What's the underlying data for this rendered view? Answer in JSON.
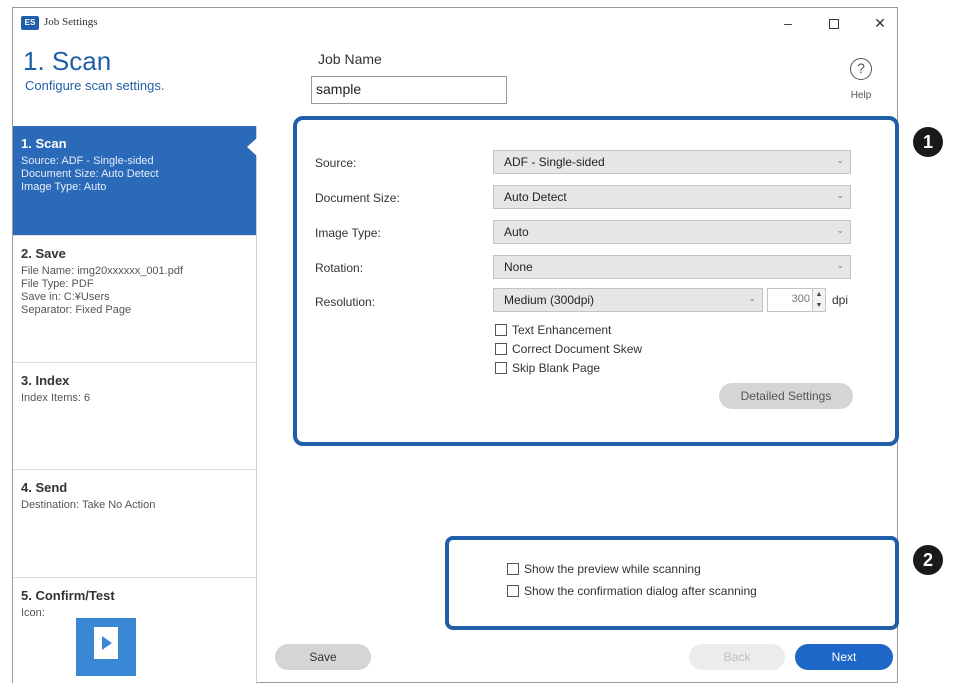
{
  "window": {
    "title": "Job Settings",
    "app_icon_text": "ES",
    "controls": {
      "minimize": "–",
      "close": "✕"
    }
  },
  "header": {
    "step_title": "1. Scan",
    "step_subtitle": "Configure scan settings.",
    "job_name_label": "Job Name",
    "job_name_value": "sample",
    "help_label": "Help",
    "help_icon": "?"
  },
  "sidebar": {
    "items": [
      {
        "title": "1. Scan",
        "lines": [
          "Source: ADF - Single-sided",
          "Document Size: Auto Detect",
          "Image Type: Auto"
        ]
      },
      {
        "title": "2. Save",
        "lines": [
          "File Name: img20xxxxxx_001.pdf",
          "File Type: PDF",
          "Save in: C:¥Users",
          "Separator: Fixed Page"
        ]
      },
      {
        "title": "3. Index",
        "lines": [
          "Index Items: 6"
        ]
      },
      {
        "title": "4. Send",
        "lines": [
          "Destination: Take No Action"
        ]
      },
      {
        "title": "5. Confirm/Test",
        "lines": [
          "Icon:"
        ]
      }
    ]
  },
  "scan_settings": {
    "source_label": "Source:",
    "source_value": "ADF - Single-sided",
    "doc_size_label": "Document Size:",
    "doc_size_value": "Auto Detect",
    "image_type_label": "Image Type:",
    "image_type_value": "Auto",
    "rotation_label": "Rotation:",
    "rotation_value": "None",
    "resolution_label": "Resolution:",
    "resolution_value": "Medium (300dpi)",
    "resolution_number": "300",
    "dpi_label": "dpi",
    "checkboxes": [
      "Text Enhancement",
      "Correct Document Skew",
      "Skip Blank Page"
    ],
    "detailed_button": "Detailed Settings"
  },
  "options": {
    "checkboxes": [
      "Show the preview while scanning",
      "Show the confirmation dialog after scanning"
    ]
  },
  "badges": [
    "1",
    "2"
  ],
  "footer": {
    "save": "Save",
    "back": "Back",
    "next": "Next"
  },
  "colors": {
    "accent": "#1f5ea8",
    "active_sidebar": "#2a6ab9",
    "next_button": "#1f66c9"
  },
  "icons": {
    "app": "scanner-app-icon",
    "help": "question-circle-icon",
    "dropdown": "chevron-down-icon",
    "job_icon": "document-play-icon"
  }
}
